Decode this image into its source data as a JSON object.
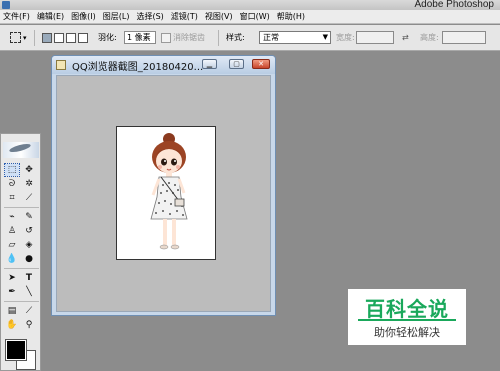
{
  "app_title": "Adobe Photoshop",
  "menu": [
    "文件(F)",
    "编辑(E)",
    "图像(I)",
    "图层(L)",
    "选择(S)",
    "滤镜(T)",
    "视图(V)",
    "窗口(W)",
    "帮助(H)"
  ],
  "options": {
    "feather_label": "羽化:",
    "feather_value": "1 像素",
    "antialias_label": "消除锯齿",
    "style_label": "样式:",
    "style_value": "正常",
    "width_label": "宽度:",
    "height_label": "高度:",
    "swap_icon": "⇄"
  },
  "document": {
    "title": "QQ浏览器截图_20180420..."
  },
  "watermark": {
    "title": "百科全说",
    "subtitle": "助你轻松解决"
  },
  "colors": {
    "foreground": "#000000",
    "background": "#ffffff",
    "workspace": "#8c8c8c",
    "brand_green": "#1aa85b"
  }
}
